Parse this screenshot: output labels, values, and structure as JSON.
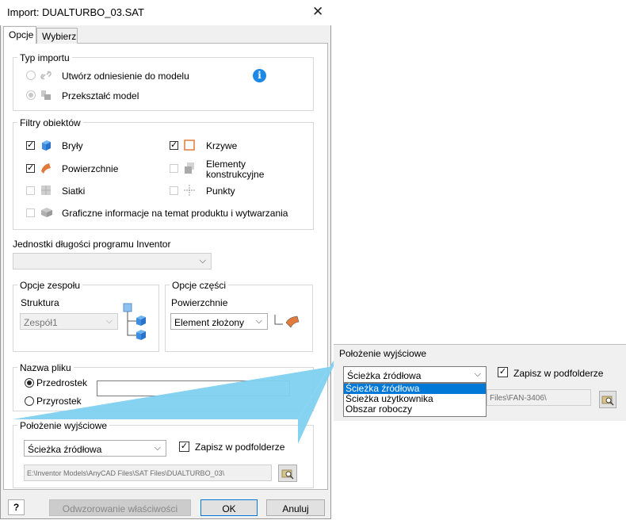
{
  "window": {
    "title": "Import: DUALTURBO_03.SAT",
    "close_glyph": "✕"
  },
  "tabs": [
    {
      "label": "Opcje"
    },
    {
      "label": "Wybierz"
    }
  ],
  "import_type": {
    "title": "Typ importu",
    "option1": "Utwórz odniesienie do modelu",
    "option2": "Przekształć model",
    "info_glyph": "i"
  },
  "filters": {
    "title": "Filtry obiektów",
    "bodies": "Bryły",
    "curves": "Krzywe",
    "surfaces": "Powierzchnie",
    "construction_1": "Elementy",
    "construction_2": "konstrukcyjne",
    "meshes": "Siatki",
    "points": "Punkty",
    "pmi": "Graficzne informacje na temat produktu i wytwarzania"
  },
  "units": {
    "title": "Jednostki długości programu Inventor",
    "value": ""
  },
  "assembly": {
    "title": "Opcje zespołu",
    "structure_label": "Struktura",
    "structure_value": "Zespół1"
  },
  "part": {
    "title": "Opcje części",
    "surfaces_label": "Powierzchnie",
    "surfaces_value": "Element złożony"
  },
  "filename": {
    "title": "Nazwa pliku",
    "prefix": "Przedrostek",
    "suffix": "Przyrostek",
    "value": ""
  },
  "location": {
    "title": "Położenie wyjściowe",
    "selected": "Ścieżka źródłowa",
    "subfolder": "Zapisz w podfolderze",
    "path": "E:\\Inventor Models\\AnyCAD Files\\SAT Files\\DUALTURBO_03\\"
  },
  "footer": {
    "help_glyph": "?",
    "mapping": "Odwzorowanie właściwości",
    "ok": "OK",
    "cancel": "Anuluj"
  },
  "zoom": {
    "title": "Położenie wyjściowe",
    "selected": "Ścieżka źródłowa",
    "subfolder": "Zapisz w podfolderze",
    "path_fragment": "Files\\FAN-3406\\",
    "options": [
      "Ścieżka źródłowa",
      "Ścieżka użytkownika",
      "Obszar roboczy"
    ]
  },
  "colors": {
    "accent": "#0078d7",
    "callout": "#7fd0f0",
    "info": "#1e88e5"
  }
}
